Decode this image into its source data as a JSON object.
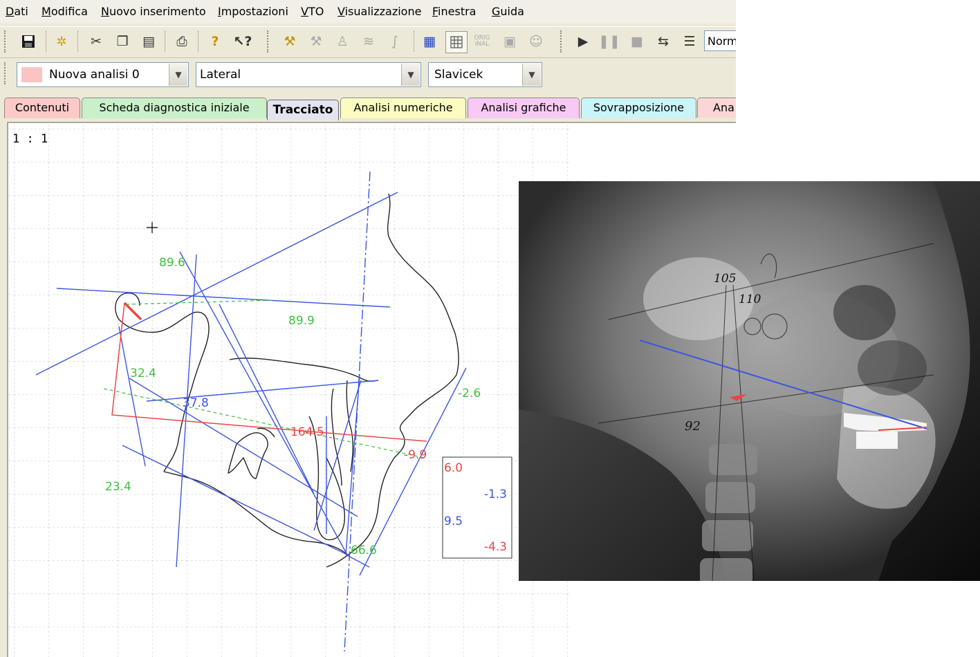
{
  "menu": [
    "Dati",
    "Modifica",
    "Nuovo inserimento",
    "Impostazioni",
    "VTO",
    "Visualizzazione",
    "Finestra",
    "Guida"
  ],
  "toolbar": {
    "zoom_value": "Norm",
    "orig_label": "ORIG INAL",
    "icons": [
      "save-icon",
      "new-icon",
      "cut-icon",
      "copy-icon",
      "paste-icon",
      "print-icon",
      "help-icon",
      "context-help-icon",
      "trace-icon",
      "trace2-icon",
      "bell-icon",
      "lines-icon",
      "curves-icon",
      "list-icon",
      "grid-icon",
      "original-icon",
      "image-icon",
      "face-icon",
      "play-icon",
      "pause-icon",
      "stop-icon",
      "loop-icon",
      "adjust-icon"
    ]
  },
  "selectors": {
    "analysis": "Nuova analisi 0",
    "view": "Lateral",
    "method": "Slavicek"
  },
  "tabs": [
    {
      "label": "Contenuti",
      "color": "#fcc9c9"
    },
    {
      "label": "Scheda diagnostica iniziale",
      "color": "#c9f0c9"
    },
    {
      "label": "Tracciato",
      "color": "#e4e4f0",
      "active": true
    },
    {
      "label": "Analisi numeriche",
      "color": "#fcfcc0"
    },
    {
      "label": "Analisi grafiche",
      "color": "#f8c9f4"
    },
    {
      "label": "Sovrapposizione",
      "color": "#c9f4f8"
    },
    {
      "label": "Ana",
      "color": "#fcd6d6"
    }
  ],
  "tracing": {
    "scale": "1 : 1",
    "values_green": [
      "89.6",
      "89.9",
      "32.4",
      "-2.6",
      "23.4",
      "66.6"
    ],
    "values_blue": [
      "37.8"
    ],
    "values_red": [
      "164.5",
      "-9.9"
    ],
    "box": {
      "v1": "6.0",
      "v2": "-1.3",
      "v3": "9.5",
      "v4": "-4.3"
    }
  },
  "xray_annotations": [
    "105",
    "110",
    "92"
  ],
  "colors": {
    "blue_line": "#3c55e0",
    "red_line": "#ee4444",
    "green_text": "#3fbf3f",
    "grid": "#c8c8c8"
  }
}
